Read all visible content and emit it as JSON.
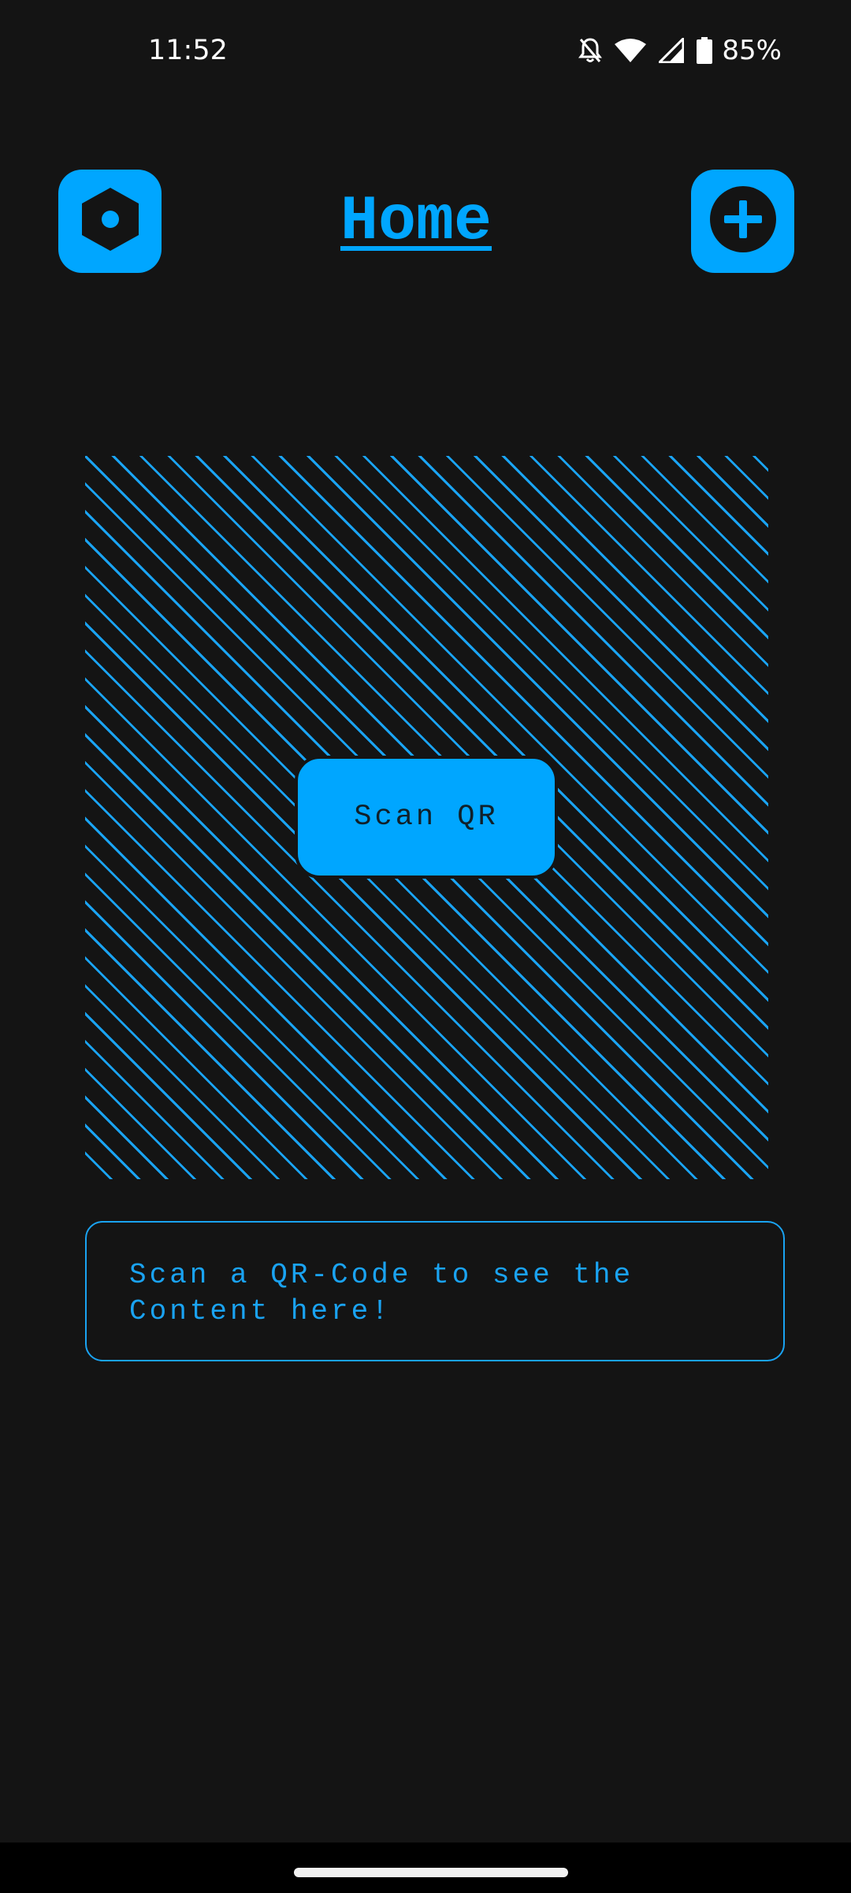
{
  "status_bar": {
    "time": "11:52",
    "battery_percent": "85%",
    "icons": [
      "notifications-off-icon",
      "wifi-icon",
      "signal-icon",
      "battery-icon"
    ]
  },
  "header": {
    "title": "Home",
    "settings_icon": "hexagon-settings-icon",
    "add_icon": "plus-circle-icon"
  },
  "scanner": {
    "button_label": "Scan QR"
  },
  "content": {
    "placeholder": "Scan a QR-Code to see the\nContent here!"
  },
  "colors": {
    "accent": "#00a6ff",
    "background": "#141414"
  }
}
